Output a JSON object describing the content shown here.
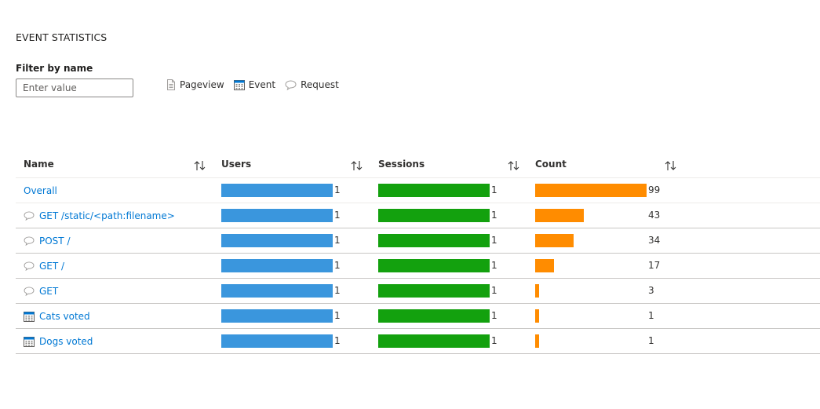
{
  "title": "EVENT STATISTICS",
  "filter": {
    "label": "Filter by name",
    "placeholder": "Enter value",
    "value": ""
  },
  "legend": [
    {
      "label": "Pageview",
      "icon": "pageview-icon"
    },
    {
      "label": "Event",
      "icon": "event-icon"
    },
    {
      "label": "Request",
      "icon": "request-icon"
    }
  ],
  "columns": {
    "name": "Name",
    "users": "Users",
    "sessions": "Sessions",
    "count": "Count"
  },
  "colors": {
    "users": "#3a96dd",
    "sessions": "#13a10e",
    "count": "#ff8c00",
    "link": "#0078d4"
  },
  "rows": [
    {
      "name": "Overall",
      "type": "",
      "users": 1,
      "sessions": 1,
      "count": 99
    },
    {
      "name": "GET /static/<path:filename>",
      "type": "request",
      "users": 1,
      "sessions": 1,
      "count": 43
    },
    {
      "name": "POST /",
      "type": "request",
      "users": 1,
      "sessions": 1,
      "count": 34
    },
    {
      "name": "GET /",
      "type": "request",
      "users": 1,
      "sessions": 1,
      "count": 17
    },
    {
      "name": "GET",
      "type": "request",
      "users": 1,
      "sessions": 1,
      "count": 3
    },
    {
      "name": "Cats voted",
      "type": "event",
      "users": 1,
      "sessions": 1,
      "count": 1
    },
    {
      "name": "Dogs voted",
      "type": "event",
      "users": 1,
      "sessions": 1,
      "count": 1
    }
  ]
}
